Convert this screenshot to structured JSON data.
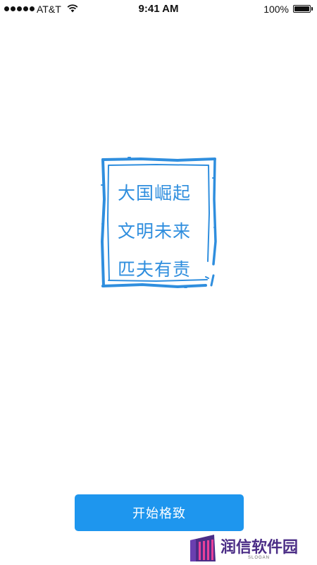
{
  "status_bar": {
    "carrier": "AT&T",
    "time": "9:41 AM",
    "battery": "100%",
    "signal_bars": 5
  },
  "stamp": {
    "lines": [
      "大国崛起",
      "文明未来",
      "匹夫有责"
    ],
    "color": "#2f8ede"
  },
  "start_button": {
    "label": "开始格致",
    "color": "#1e96ee"
  },
  "watermark": {
    "brand": "润信软件园",
    "slogan": "SLOGAN",
    "icon": "building-logo-icon"
  }
}
